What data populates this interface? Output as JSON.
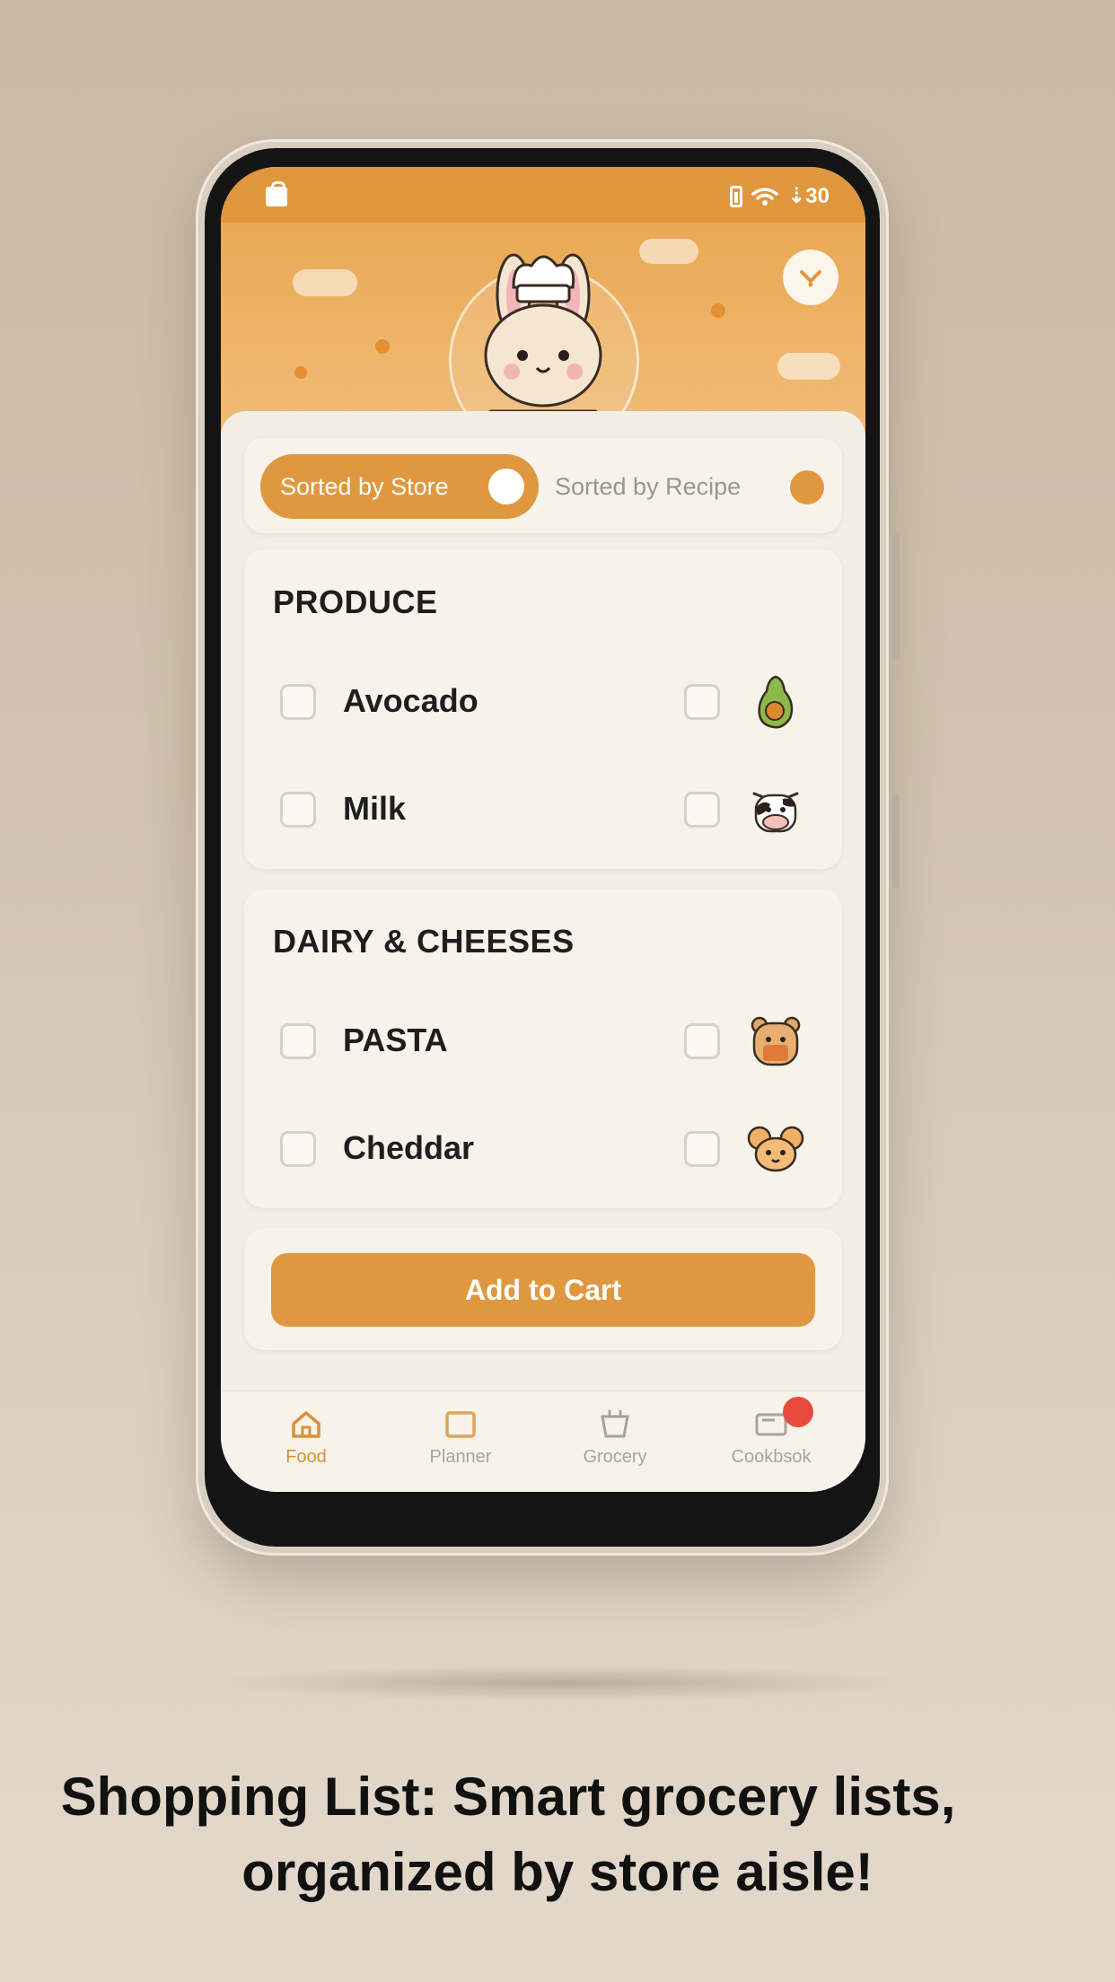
{
  "status_bar": {
    "right_text": "⇣30"
  },
  "toggle": {
    "active_label": "Sorted by Store",
    "inactive_label": "Sorted by Recipe"
  },
  "sections": [
    {
      "title": "PRODUCE",
      "items": [
        {
          "label": "Avocado",
          "icon": "avocado-icon"
        },
        {
          "label": "Milk",
          "icon": "cow-icon"
        }
      ]
    },
    {
      "title": "DAIRY & CHEESES",
      "items": [
        {
          "label": "PASTA",
          "icon": "bear-icon"
        },
        {
          "label": "Cheddar",
          "icon": "mouse-icon"
        }
      ]
    }
  ],
  "cart_button": {
    "label": "Add to Cart"
  },
  "nav": [
    {
      "label": "Food",
      "icon": "home-icon",
      "active": true
    },
    {
      "label": "Planner",
      "icon": "planner-icon",
      "active": false
    },
    {
      "label": "Grocery",
      "icon": "basket-icon",
      "active": false
    },
    {
      "label": "Cookbsok",
      "icon": "cookbook-icon",
      "active": false,
      "badge": true
    }
  ],
  "caption": {
    "line1": "Shopping List: Smart grocery lists,",
    "line2": "organized by store aisle!"
  },
  "colors": {
    "accent": "#e09840",
    "header": "#eaa955",
    "badge": "#e84b3c",
    "background": "#f3efe6"
  }
}
